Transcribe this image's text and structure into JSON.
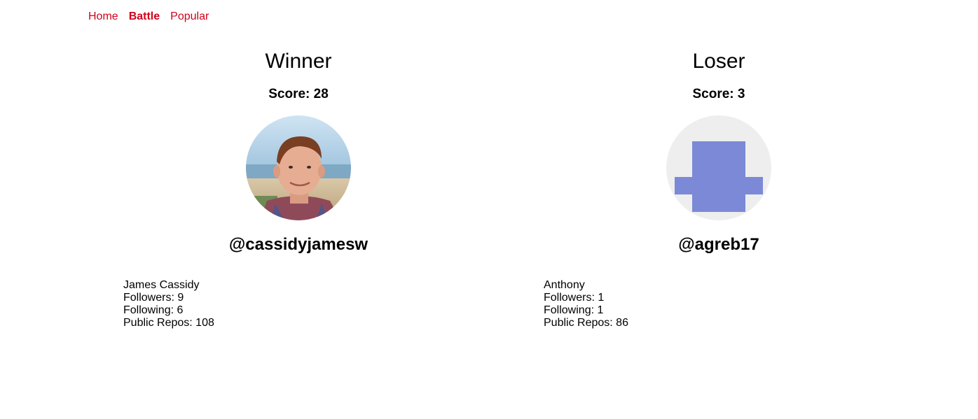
{
  "nav": {
    "items": [
      {
        "label": "Home",
        "active": false
      },
      {
        "label": "Battle",
        "active": true
      },
      {
        "label": "Popular",
        "active": false
      }
    ]
  },
  "players": {
    "winner": {
      "header": "Winner",
      "score": "Score: 28",
      "username": "@cassidyjamesw",
      "name": "James Cassidy",
      "followers": "Followers: 9",
      "following": "Following: 6",
      "repos": "Public Repos: 108",
      "avatar": "profile-photo"
    },
    "loser": {
      "header": "Loser",
      "score": "Score: 3",
      "username": "@agreb17",
      "name": "Anthony",
      "followers": "Followers: 1",
      "following": "Following: 1",
      "repos": "Public Repos: 86",
      "avatar": "identicon",
      "identicon_color": "#7c89d6",
      "identicon_bg": "#eeeeee"
    }
  },
  "colors": {
    "accent": "#d0021b"
  }
}
